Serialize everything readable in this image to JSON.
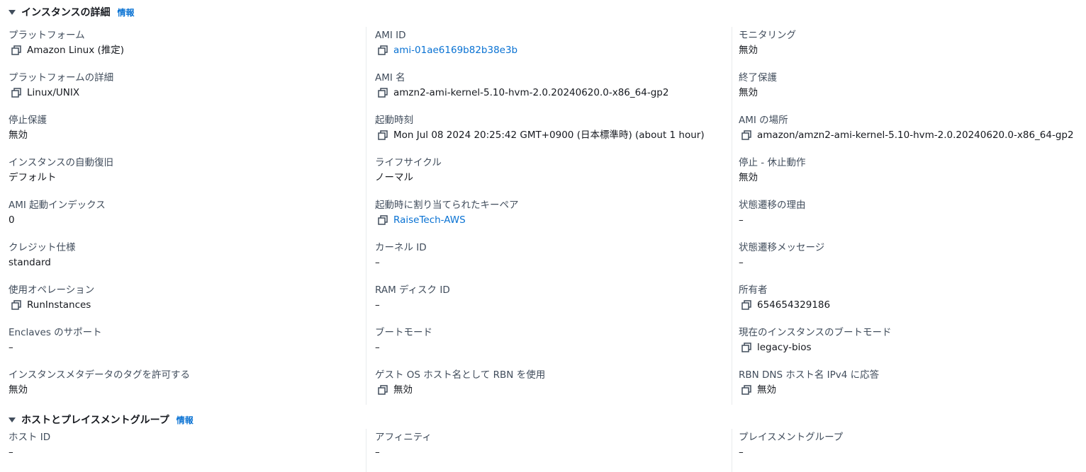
{
  "instance_details": {
    "title": "インスタンスの詳細",
    "info_label": "情報",
    "columns": [
      [
        {
          "label": "プラットフォーム",
          "value": "Amazon Linux (推定)",
          "copy": true,
          "link": false
        },
        {
          "label": "プラットフォームの詳細",
          "value": "Linux/UNIX",
          "copy": true,
          "link": false
        },
        {
          "label": "停止保護",
          "value": "無効",
          "copy": false,
          "link": false
        },
        {
          "label": "インスタンスの自動復旧",
          "value": "デフォルト",
          "copy": false,
          "link": false
        },
        {
          "label": "AMI 起動インデックス",
          "value": "0",
          "copy": false,
          "link": false
        },
        {
          "label": "クレジット仕様",
          "value": "standard",
          "copy": false,
          "link": false
        },
        {
          "label": "使用オペレーション",
          "value": "RunInstances",
          "copy": true,
          "link": false
        },
        {
          "label": "Enclaves のサポート",
          "value": "–",
          "copy": false,
          "link": false
        },
        {
          "label": "インスタンスメタデータのタグを許可する",
          "value": "無効",
          "copy": false,
          "link": false
        }
      ],
      [
        {
          "label": "AMI ID",
          "value": "ami-01ae6169b82b38e3b",
          "copy": true,
          "link": true
        },
        {
          "label": "AMI 名",
          "value": "amzn2-ami-kernel-5.10-hvm-2.0.20240620.0-x86_64-gp2",
          "copy": true,
          "link": false
        },
        {
          "label": "起動時刻",
          "value": "Mon Jul 08 2024 20:25:42 GMT+0900 (日本標準時) (about 1 hour)",
          "copy": true,
          "link": false
        },
        {
          "label": "ライフサイクル",
          "value": "ノーマル",
          "copy": false,
          "link": false
        },
        {
          "label": "起動時に割り当てられたキーペア",
          "value": "RaiseTech-AWS",
          "copy": true,
          "link": true
        },
        {
          "label": "カーネル ID",
          "value": "–",
          "copy": false,
          "link": false
        },
        {
          "label": "RAM ディスク ID",
          "value": "–",
          "copy": false,
          "link": false
        },
        {
          "label": "ブートモード",
          "value": "–",
          "copy": false,
          "link": false
        },
        {
          "label": "ゲスト OS ホスト名として RBN を使用",
          "value": "無効",
          "copy": true,
          "link": false
        }
      ],
      [
        {
          "label": "モニタリング",
          "value": "無効",
          "copy": false,
          "link": false
        },
        {
          "label": "終了保護",
          "value": "無効",
          "copy": false,
          "link": false
        },
        {
          "label": "AMI の場所",
          "value": "amazon/amzn2-ami-kernel-5.10-hvm-2.0.20240620.0-x86_64-gp2",
          "copy": true,
          "link": false
        },
        {
          "label": "停止 - 休止動作",
          "value": "無効",
          "copy": false,
          "link": false
        },
        {
          "label": "状態遷移の理由",
          "value": "–",
          "copy": false,
          "link": false
        },
        {
          "label": "状態遷移メッセージ",
          "value": "–",
          "copy": false,
          "link": false
        },
        {
          "label": "所有者",
          "value": "654654329186",
          "copy": true,
          "link": false
        },
        {
          "label": "現在のインスタンスのブートモード",
          "value": "legacy-bios",
          "copy": true,
          "link": false
        },
        {
          "label": "RBN DNS ホスト名 IPv4 に応答",
          "value": "無効",
          "copy": true,
          "link": false
        }
      ]
    ]
  },
  "host_placement": {
    "title": "ホストとプレイスメントグループ",
    "info_label": "情報",
    "columns": [
      [
        {
          "label": "ホスト ID",
          "value": "–",
          "copy": false,
          "link": false
        }
      ],
      [
        {
          "label": "アフィニティ",
          "value": "–",
          "copy": false,
          "link": false
        }
      ],
      [
        {
          "label": "プレイスメントグループ",
          "value": "–",
          "copy": false,
          "link": false
        }
      ]
    ]
  },
  "colors": {
    "link": "#0972d3",
    "label": "#414d5c",
    "text": "#16191f",
    "divider": "#e9ebed"
  },
  "icons": {
    "copy": "copy-icon",
    "caret": "caret-down-icon"
  }
}
